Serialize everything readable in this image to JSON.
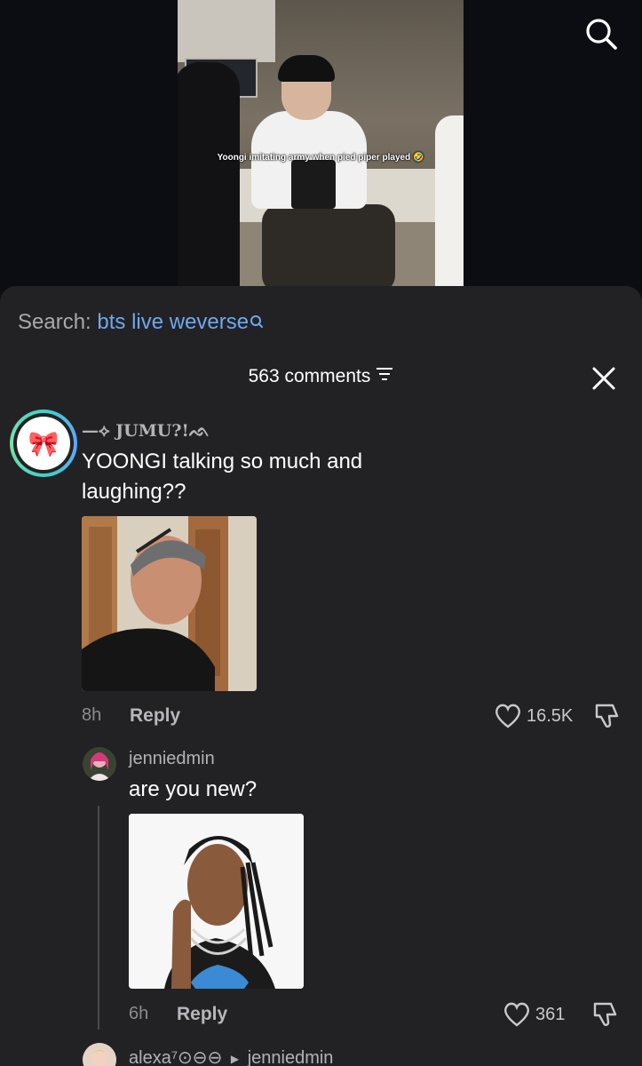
{
  "video": {
    "caption": "Yoongi imitating army when pied piper played 🤣"
  },
  "sheet": {
    "search_label": "Search:",
    "search_query": "bts live weverse",
    "comments_count": "563 comments"
  },
  "comments": [
    {
      "username": "—⟡ JUMU?!ᨒ",
      "text_line1": "YOONGI talking so much and",
      "text_line2": "laughing??",
      "time": "8h",
      "reply_label": "Reply",
      "likes": "16.5K",
      "avatar_icon": "bow-emoji",
      "avatar_glyph": "🎀"
    },
    {
      "username": "jenniedmin",
      "text_line1": "are you new?",
      "time": "6h",
      "reply_label": "Reply",
      "likes": "361"
    },
    {
      "username": "alexa⁷⊙⊖⊖",
      "reply_to": "jenniedmin"
    }
  ],
  "colors": {
    "sheet_bg": "#222224",
    "link_blue": "#6fa8ee",
    "avatar_ring": "#3fd2c7"
  }
}
